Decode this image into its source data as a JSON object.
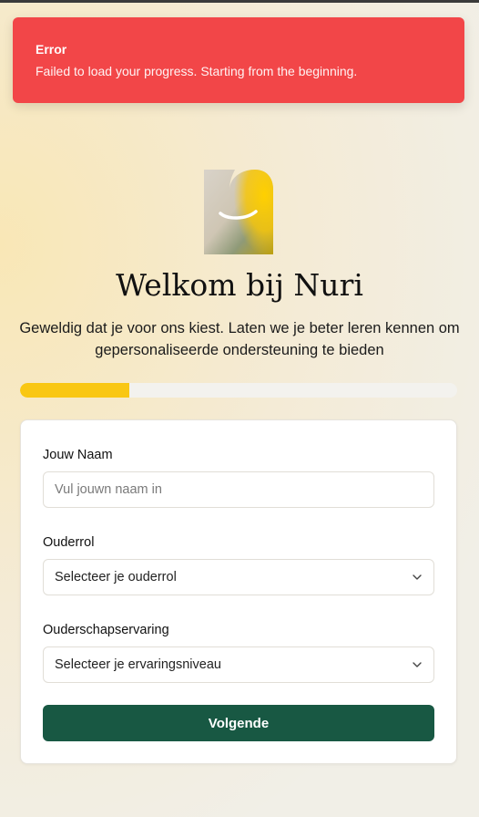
{
  "toast": {
    "title": "Error",
    "message": "Failed to load your progress. Starting from the beginning."
  },
  "header": {
    "title": "Welkom bij Nuri",
    "subtitle": "Geweldig dat je voor ons kiest. Laten we je beter leren kennen om gepersonaliseerde ondersteuning te bieden"
  },
  "progress": {
    "fraction": 0.25,
    "color": "#f9c713"
  },
  "form": {
    "name_label": "Jouw Naam",
    "name_placeholder": "Vul jouwn naam in",
    "role_label": "Ouderrol",
    "role_value": "Selecteer je ouderrol",
    "experience_label": "Ouderschapservaring",
    "experience_value": "Selecteer je ervaringsniveau",
    "submit_label": "Volgende"
  },
  "colors": {
    "error": "#f24648",
    "accent": "#f9c713",
    "primary_button": "#185843"
  },
  "icons": {
    "logo": "nuri-logo-icon",
    "select_arrow": "chevron-down-icon"
  }
}
